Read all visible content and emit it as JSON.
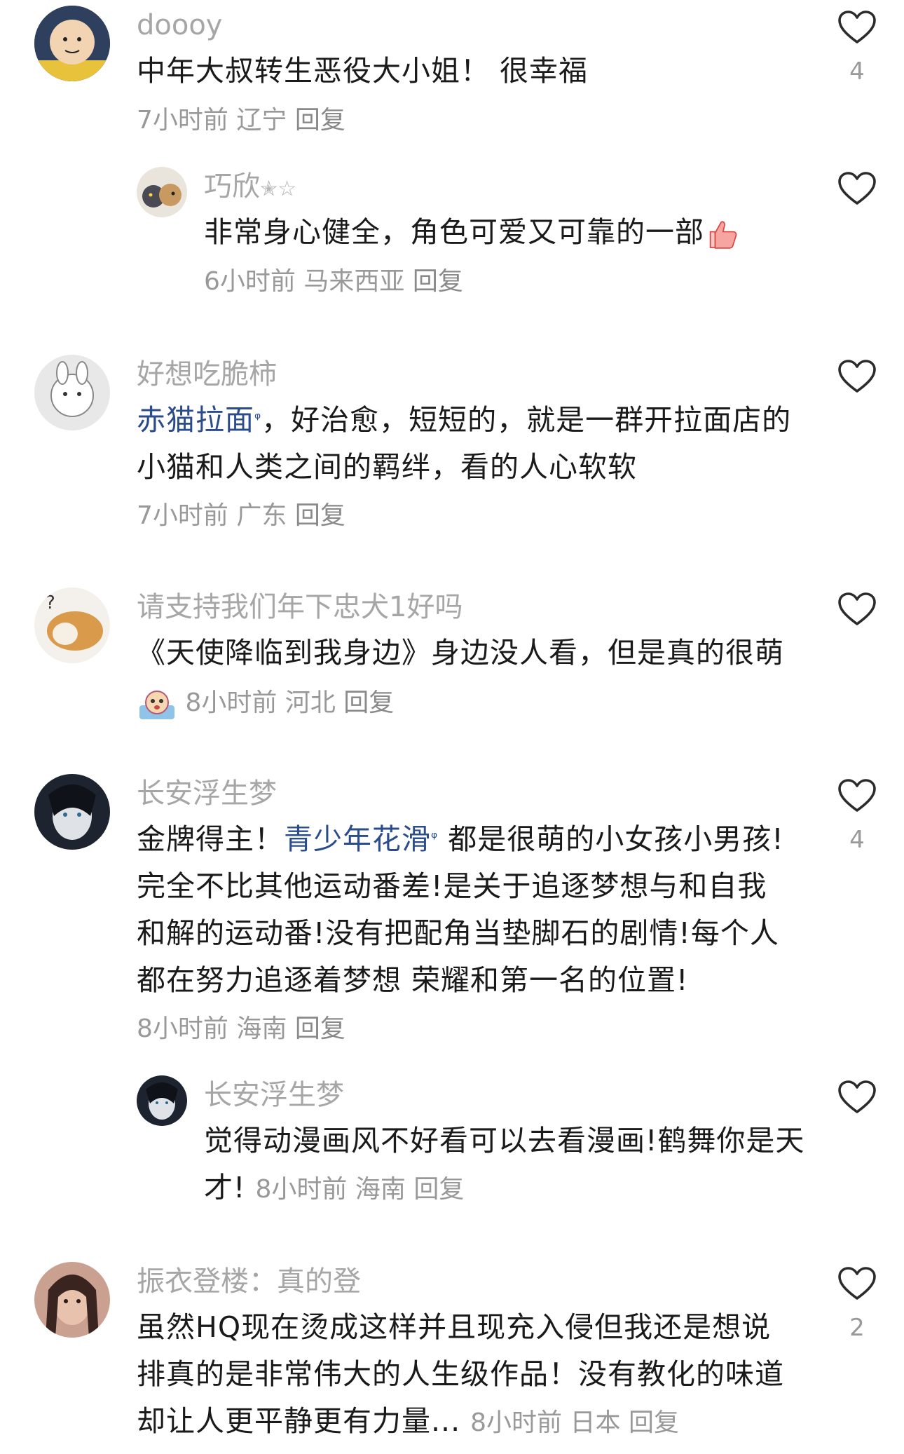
{
  "colors": {
    "text": "#1a1a1a",
    "username": "#a6a6a6",
    "meta": "#999999",
    "link": "#2b4c8c",
    "icon": "#2b2b2b"
  },
  "comments": [
    {
      "user": "doooy",
      "text": "中年大叔转生恶役大小姐！ 很幸福",
      "time": "7小时前",
      "region": "辽宁",
      "reply": "回复",
      "likes": "4"
    },
    {
      "user": "巧欣",
      "badge": "✭☆",
      "text": "非常身心健全，角色可爱又可靠的一部",
      "emoji": "👍",
      "time": "6小时前",
      "region": "马来西亚",
      "reply": "回复"
    },
    {
      "user": "好想吃脆柿",
      "link": "赤猫拉面",
      "text": "，好治愈，短短的，就是一群开拉面店的小猫和人类之间的羁绊，看的人心软软",
      "time": "7小时前",
      "region": "广东",
      "reply": "回复"
    },
    {
      "user": "请支持我们年下忠犬1好吗",
      "text": "《天使降临到我身边》身边没人看，但是真的很萌",
      "time": "8小时前",
      "region": "河北",
      "reply": "回复"
    },
    {
      "user": "长安浮生梦",
      "pre": "金牌得主！",
      "link": "青少年花滑",
      "text": "都是很萌的小女孩小男孩!完全不比其他运动番差!是关于追逐梦想与和自我和解的运动番!没有把配角当垫脚石的剧情!每个人都在努力追逐着梦想 荣耀和第一名的位置!",
      "time": "8小时前",
      "region": "海南",
      "reply": "回复",
      "likes": "4"
    },
    {
      "user": "长安浮生梦",
      "text": "觉得动漫画风不好看可以去看漫画!鹤舞你是天才!",
      "time": "8小时前",
      "region": "海南",
      "reply": "回复"
    },
    {
      "user": "振衣登楼：真的登",
      "text": "虽然HQ现在烫成这样并且现充入侵但我还是想说排真的是非常伟大的人生级作品！没有教化的味道却让人更平静更有力量...",
      "time": "8小时前",
      "region": "日本",
      "reply": "回复",
      "likes": "2"
    }
  ]
}
